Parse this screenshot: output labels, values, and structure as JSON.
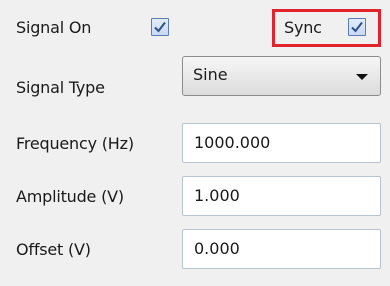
{
  "signal_on": {
    "label": "Signal On",
    "checked": true
  },
  "sync": {
    "label": "Sync",
    "checked": true
  },
  "signal_type": {
    "label": "Signal Type",
    "selected": "Sine"
  },
  "frequency": {
    "label": "Frequency (Hz)",
    "value": "1000.000"
  },
  "amplitude": {
    "label": "Amplitude (V)",
    "value": "1.000"
  },
  "offset": {
    "label": "Offset (V)",
    "value": "0.000"
  },
  "colors": {
    "highlight_border": "#e3232c",
    "checkbox_border": "#5a7db8",
    "background": "#f0f0f0"
  }
}
